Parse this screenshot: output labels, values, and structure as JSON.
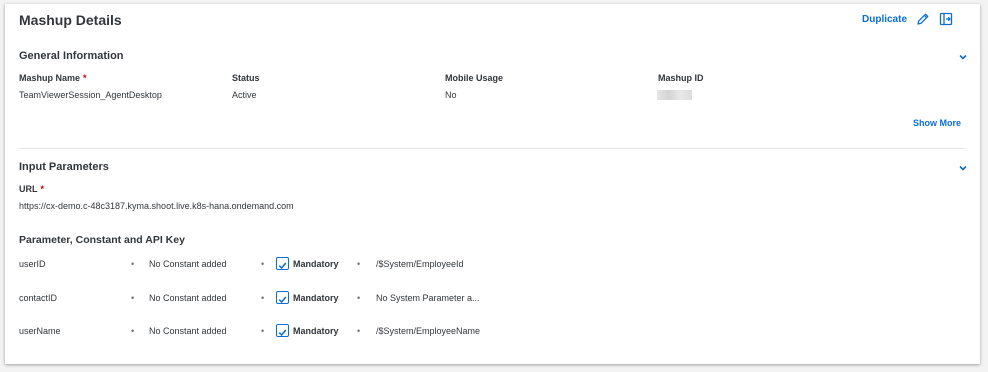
{
  "header": {
    "title": "Mashup Details",
    "duplicate_label": "Duplicate"
  },
  "general": {
    "title": "General Information",
    "columns": [
      {
        "label": "Mashup Name",
        "required": "*",
        "value": "TeamViewerSession_AgentDesktop"
      },
      {
        "label": "Status",
        "value": "Active"
      },
      {
        "label": "Mobile Usage",
        "value": "No"
      },
      {
        "label": "Mashup ID",
        "value": ""
      }
    ],
    "show_more": "Show More"
  },
  "input": {
    "title": "Input Parameters",
    "url_label": "URL",
    "url_required": "*",
    "url_value": "https://cx-demo.c-48c3187.kyma.shoot.live.k8s-hana.ondemand.com",
    "params_title": "Parameter, Constant and API Key",
    "bullet": "•",
    "rows": [
      {
        "name": "userID",
        "constant": "No Constant added",
        "mandatory": "Mandatory",
        "system": "/$System/EmployeeId"
      },
      {
        "name": "contactID",
        "constant": "No Constant added",
        "mandatory": "Mandatory",
        "system": "No System Parameter a..."
      },
      {
        "name": "userName",
        "constant": "No Constant added",
        "mandatory": "Mandatory",
        "system": "/$System/EmployeeName"
      }
    ]
  },
  "colors": {
    "accent": "#0a6ed1",
    "text": "#32363a",
    "required": "#bb0000"
  },
  "icons": [
    "pencil-icon",
    "exit-icon",
    "chevron-down-icon",
    "checkbox-checked-icon"
  ]
}
